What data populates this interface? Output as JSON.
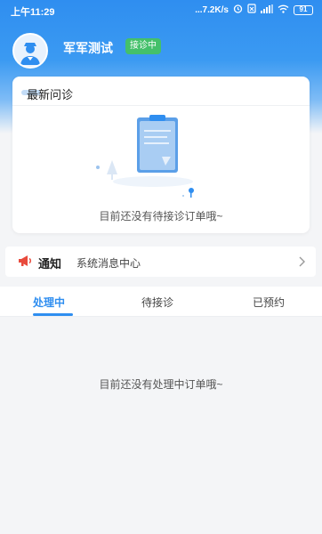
{
  "status_bar": {
    "time": "上午11:29",
    "network_speed": "...7.2K/s",
    "battery": "91"
  },
  "profile": {
    "name": "军军测试",
    "status_badge": "接诊中"
  },
  "latest_consult": {
    "title": "最新问诊",
    "empty_text": "目前还没有待接诊订单哦~"
  },
  "notice": {
    "title": "通知",
    "subtitle": "系统消息中心"
  },
  "tabs": [
    {
      "label": "处理中",
      "active": true
    },
    {
      "label": "待接诊",
      "active": false
    },
    {
      "label": "已预约",
      "active": false
    }
  ],
  "processing": {
    "empty_text": "目前还没有处理中订单哦~"
  },
  "colors": {
    "primary": "#2f8ef0",
    "badge": "#44c06a",
    "notice_icon": "#e84a3c"
  }
}
